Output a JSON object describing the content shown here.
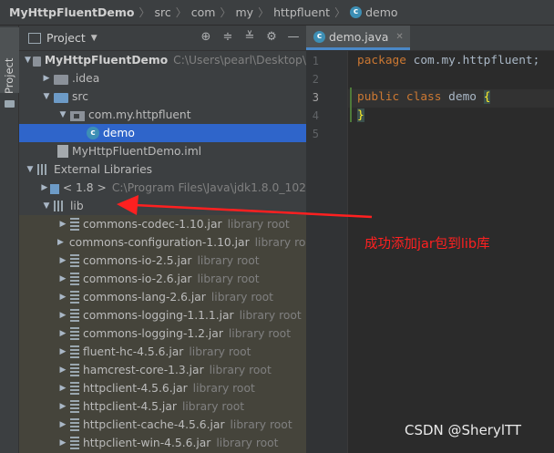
{
  "breadcrumb": {
    "project": "MyHttpFluentDemo",
    "parts": [
      "src",
      "com",
      "my",
      "httpfluent"
    ],
    "file": "demo"
  },
  "toolstrip": {
    "label": "Project"
  },
  "project_panel": {
    "title": "Project",
    "tools": [
      "target-icon",
      "collapse-icon",
      "expand-icon",
      "gear-icon",
      "minimize-icon"
    ]
  },
  "tree": {
    "root": {
      "name": "MyHttpFluentDemo",
      "path": "C:\\Users\\pearl\\Desktop\\"
    },
    "idea": ".idea",
    "src": "src",
    "package": "com.my.httpfluent",
    "demo": "demo",
    "iml": "MyHttpFluentDemo.iml",
    "external": "External Libraries",
    "jdk": {
      "name": "< 1.8 >",
      "path": "C:\\Program Files\\Java\\jdk1.8.0_102"
    },
    "lib": "lib",
    "jars": [
      {
        "name": "commons-codec-1.10.jar",
        "hint": "library root"
      },
      {
        "name": "commons-configuration-1.10.jar",
        "hint": "library root"
      },
      {
        "name": "commons-io-2.5.jar",
        "hint": "library root"
      },
      {
        "name": "commons-io-2.6.jar",
        "hint": "library root"
      },
      {
        "name": "commons-lang-2.6.jar",
        "hint": "library root"
      },
      {
        "name": "commons-logging-1.1.1.jar",
        "hint": "library root"
      },
      {
        "name": "commons-logging-1.2.jar",
        "hint": "library root"
      },
      {
        "name": "fluent-hc-4.5.6.jar",
        "hint": "library root"
      },
      {
        "name": "hamcrest-core-1.3.jar",
        "hint": "library root"
      },
      {
        "name": "httpclient-4.5.6.jar",
        "hint": "library root"
      },
      {
        "name": "httpclient-4.5.jar",
        "hint": "library root"
      },
      {
        "name": "httpclient-cache-4.5.6.jar",
        "hint": "library root"
      },
      {
        "name": "httpclient-win-4.5.6.jar",
        "hint": "library root"
      }
    ]
  },
  "editor": {
    "tab": "demo.java",
    "line_numbers": [
      "1",
      "2",
      "3",
      "4",
      "5"
    ],
    "code": {
      "line1_kw": "package",
      "line1_rest": " com.my.httpfluent;",
      "line3_kw": "public class",
      "line3_name": " demo ",
      "line3_brace": "{",
      "line4_brace": "}"
    }
  },
  "annotation": "成功添加jar包到lib库",
  "watermark": "CSDN @SherylTT",
  "colors": {
    "annotation": "#ff2020",
    "selection": "#2f65ca",
    "keyword": "#cc7832"
  }
}
